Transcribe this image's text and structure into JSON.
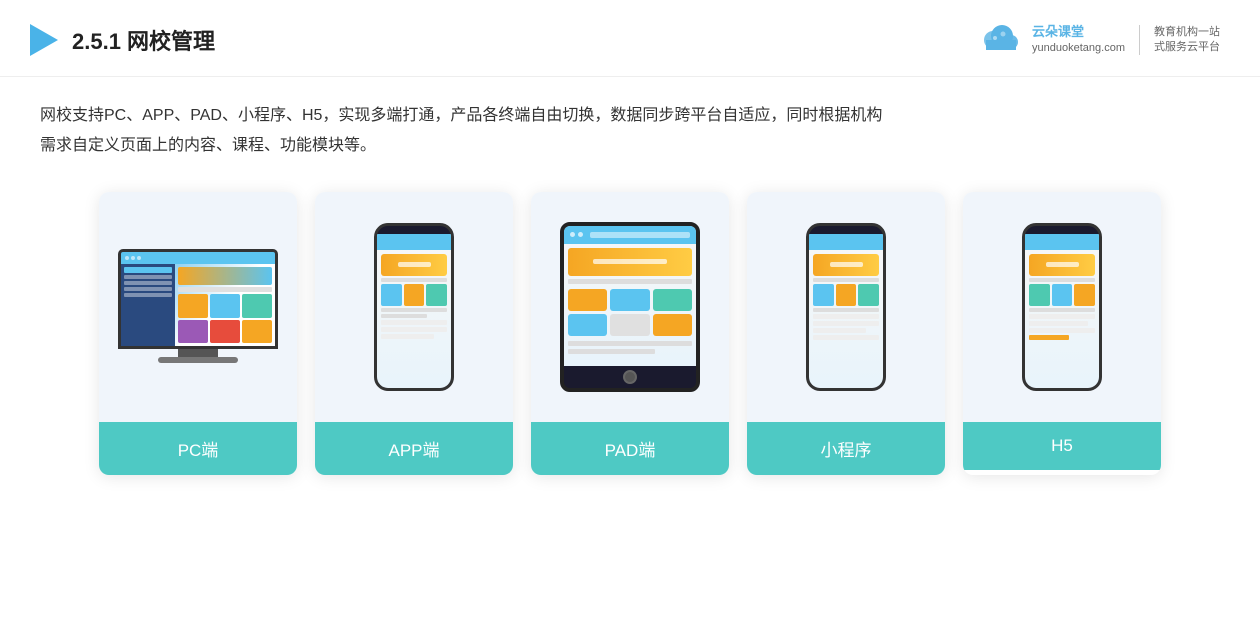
{
  "header": {
    "title_prefix": "2.5.1 ",
    "title_bold": "网校管理",
    "logo_brand": "云朵课堂",
    "logo_url": "yunduoketang.com",
    "logo_tagline_1": "教育机构一站",
    "logo_tagline_2": "式服务云平台"
  },
  "description": {
    "line1": "网校支持PC、APP、PAD、小程序、H5，实现多端打通，产品各终端自由切换，数据同步跨平台自适应，同时根据机构",
    "line2": "需求自定义页面上的内容、课程、功能模块等。"
  },
  "cards": [
    {
      "label": "PC端"
    },
    {
      "label": "APP端"
    },
    {
      "label": "PAD端"
    },
    {
      "label": "小程序"
    },
    {
      "label": "H5"
    }
  ]
}
